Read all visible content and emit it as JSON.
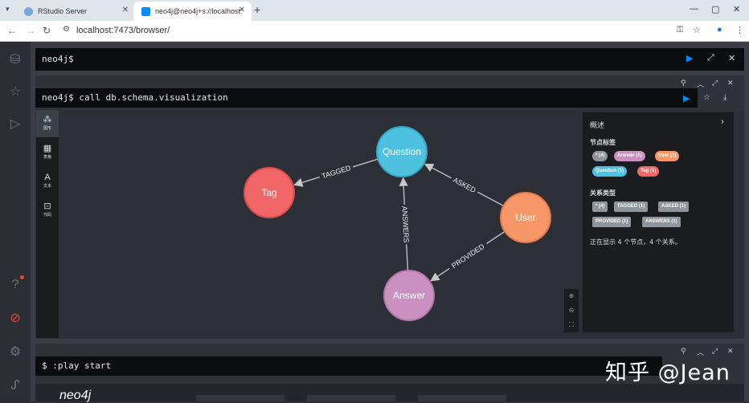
{
  "browser": {
    "tabs": [
      {
        "label": "RStudio Server",
        "active": false,
        "icon_color": "#75aadb"
      },
      {
        "label": "neo4j@neo4j+s://localhost:",
        "active": true,
        "icon_color": "#018bff"
      }
    ],
    "url": "localhost:7473/browser/"
  },
  "editor": {
    "prompt": "neo4j$"
  },
  "result_frame": {
    "command": "neo4j$ call db.schema.visualization",
    "view_tabs": [
      {
        "label": "图形",
        "icon": "graph-icon"
      },
      {
        "label": "表格",
        "icon": "table-icon"
      },
      {
        "label": "文本",
        "icon": "text-icon"
      },
      {
        "label": "代码",
        "icon": "code-icon"
      }
    ],
    "graph": {
      "nodes": [
        {
          "id": "question",
          "label": "Question",
          "color": "#4ec1e0",
          "stroke": "#36a7c7"
        },
        {
          "id": "tag",
          "label": "Tag",
          "color": "#f16667",
          "stroke": "#d94a4b"
        },
        {
          "id": "user",
          "label": "User",
          "color": "#f79767",
          "stroke": "#e07a48"
        },
        {
          "id": "answer",
          "label": "Answer",
          "color": "#c990c0",
          "stroke": "#b275a8"
        }
      ],
      "edges": [
        {
          "from": "question",
          "to": "tag",
          "label": "TAGGED"
        },
        {
          "from": "user",
          "to": "question",
          "label": "ASKED"
        },
        {
          "from": "answer",
          "to": "question",
          "label": "ANSWERS"
        },
        {
          "from": "user",
          "to": "answer",
          "label": "PROVIDED"
        }
      ]
    },
    "overview": {
      "title": "概述",
      "node_labels_heading": "节点标签",
      "node_labels": [
        {
          "label": "* (4)",
          "color": "#8e949b"
        },
        {
          "label": "Answer (1)",
          "color": "#c990c0"
        },
        {
          "label": "User (1)",
          "color": "#f79767"
        },
        {
          "label": "Question (1)",
          "color": "#4ec1e0"
        },
        {
          "label": "Tag (1)",
          "color": "#f16667"
        }
      ],
      "rel_types_heading": "关系类型",
      "rel_types": [
        "* (4)",
        "TAGGED (1)",
        "ASKED (1)",
        "PROVIDED (1)",
        "ANSWERS (1)"
      ],
      "note": "正在显示 4 个节点，4 个关系。"
    }
  },
  "second_frame": {
    "command": "$ :play start",
    "logo": "neo4j"
  },
  "watermark": "知乎 @Jean"
}
